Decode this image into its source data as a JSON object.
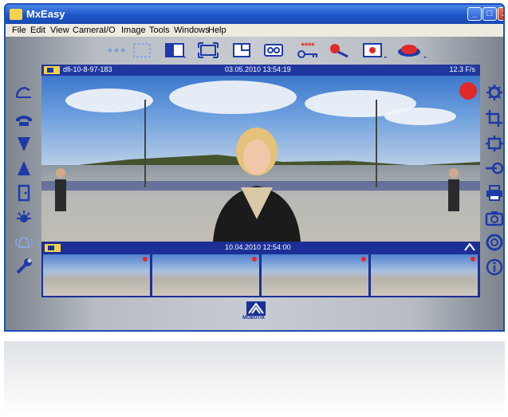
{
  "window": {
    "title": "MxEasy",
    "controls": {
      "minimize": "_",
      "maximize": "□",
      "close": "X"
    }
  },
  "menu": [
    "File",
    "Edit",
    "View",
    "Camera",
    "I/O",
    "Image",
    "Tools",
    "Windows",
    "Help"
  ],
  "toolbar": {
    "password_stars": "****"
  },
  "live_view": {
    "camera_name": "dfi-10-8-97-183",
    "timestamp": "03.05.2010 13:54:19",
    "frame_rate": "12.3 F/s"
  },
  "thumbnail_strip": {
    "timestamp": "10.04.2010 12:54:00"
  },
  "brand": {
    "logo_text": "MOBOTIX"
  },
  "colors": {
    "title_bar": "#1d56c8",
    "video_bar": "#20379e",
    "record_indicator": "#e02a2a",
    "icon_blue": "#1e3aa8"
  }
}
